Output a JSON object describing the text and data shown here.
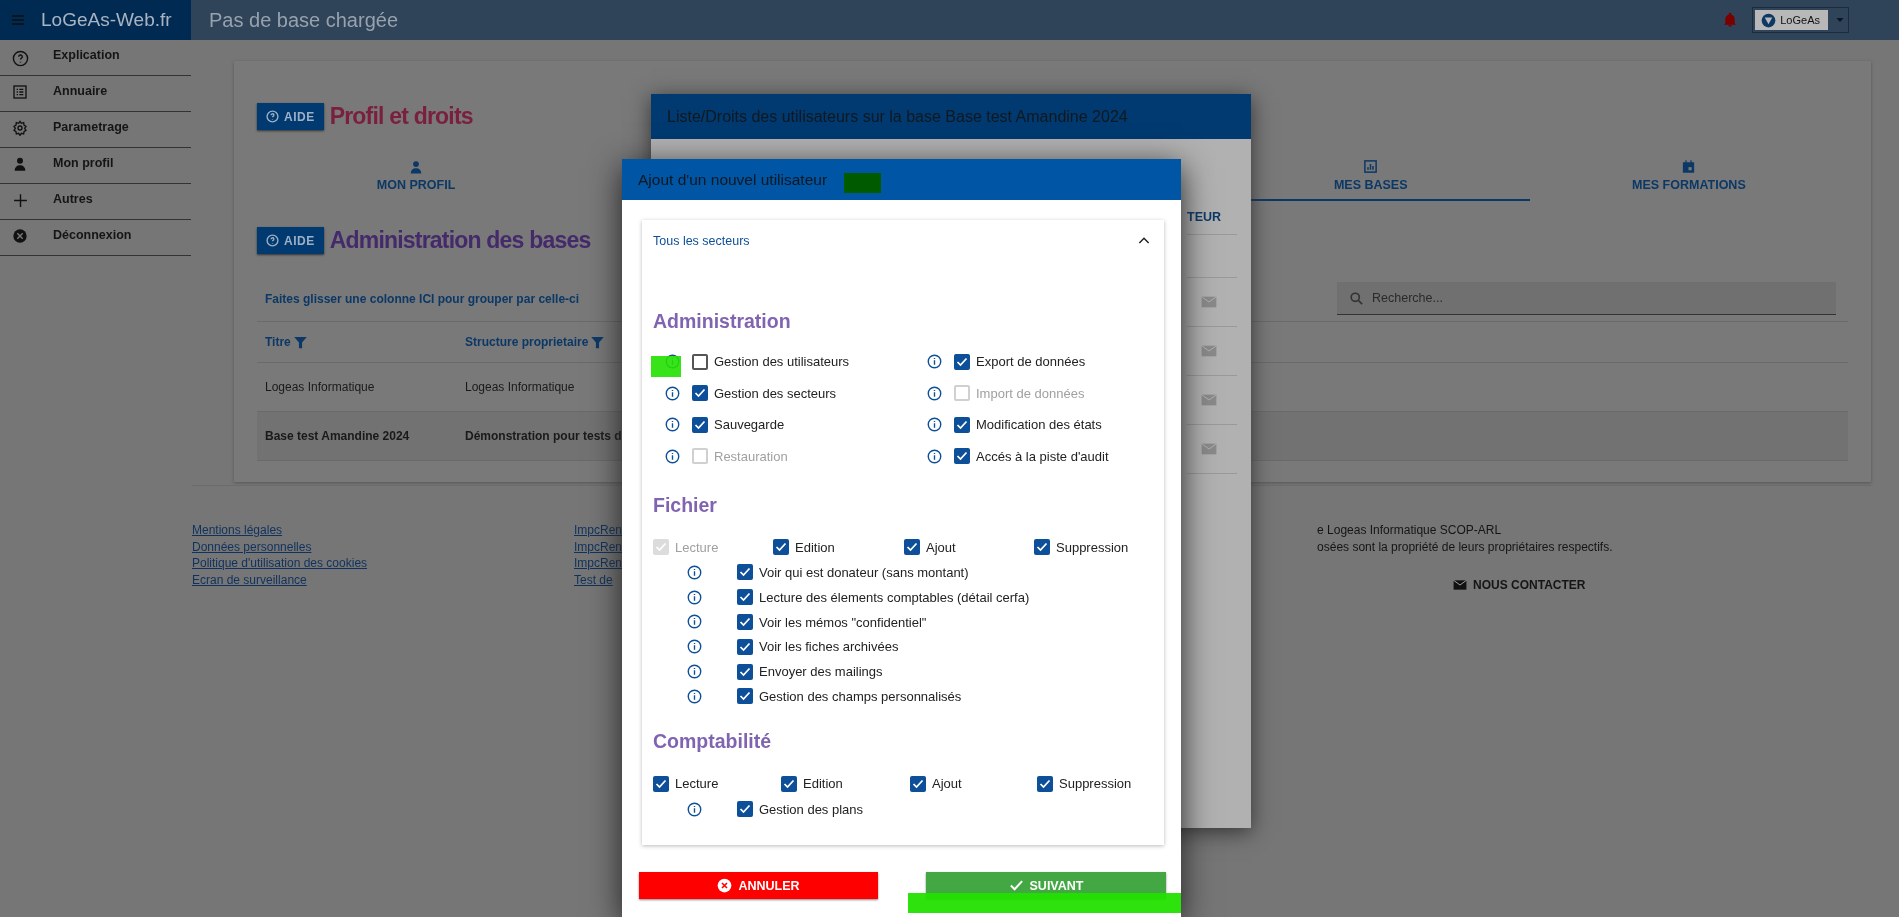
{
  "app_bar": {
    "brand": "LoGeAs-Web.fr",
    "title": "Pas de base chargée",
    "user_button": "LoGeAs"
  },
  "sidebar": {
    "items": [
      {
        "label": "Explication"
      },
      {
        "label": "Annuaire"
      },
      {
        "label": "Parametrage"
      },
      {
        "label": "Mon profil"
      },
      {
        "label": "Autres"
      },
      {
        "label": "Déconnexion"
      }
    ]
  },
  "profile_section": {
    "help_button": "AIDE",
    "title": "Profil et droits",
    "tabs": [
      {
        "label": "MON PROFIL",
        "selected": false
      },
      {
        "label": "MES BASES",
        "selected": true
      },
      {
        "label": "MES FORMATIONS",
        "selected": false
      }
    ]
  },
  "bases_section": {
    "help_button": "AIDE",
    "title": "Administration des bases",
    "group_hint": "Faites glisser une colonne ICI pour grouper par celle-ci",
    "search": {
      "placeholder": "Recherche..."
    },
    "columns": [
      "Titre",
      "Structure proprietaire"
    ],
    "rows": [
      {
        "cells": [
          "Logeas Informatique",
          "Logeas Informatique"
        ],
        "selected": false
      },
      {
        "cells": [
          "Base test Amandine 2024",
          "Démonstration pour tests d"
        ],
        "selected": true
      }
    ]
  },
  "footer": {
    "links": [
      "Mentions légales",
      "Données personnelles",
      "Politique d'utilisation des cookies",
      "Ecran de surveillance"
    ],
    "links_2": [
      "ImpcRen",
      "ImpcRen",
      "ImpcRen",
      "Test de"
    ],
    "notice_lines": [
      "e Logeas Informatique SCOP-ARL",
      "osées sont la propriété de leurs propriétaires respectifs."
    ],
    "contact_button": "NOUS CONTACTER"
  },
  "users_dialog": {
    "title": "Liste/Droits des utilisateurs sur la base Base test Amandine 2024",
    "column_header": "TEUR"
  },
  "new_user_dialog": {
    "title": "Ajout d'un nouvel utilisateur",
    "sectors": {
      "label": "Tous les secteurs",
      "expanded": true
    },
    "sections": [
      {
        "title": "Administration",
        "kind": "two_column",
        "options": [
          {
            "label": "Gestion des utilisateurs",
            "checked": false,
            "disabled": false
          },
          {
            "label": "Export de données",
            "checked": true,
            "disabled": false
          },
          {
            "label": "Gestion des secteurs",
            "checked": true,
            "disabled": false
          },
          {
            "label": "Import de données",
            "checked": false,
            "disabled": true
          },
          {
            "label": "Sauvegarde",
            "checked": true,
            "disabled": false
          },
          {
            "label": "Modification des états",
            "checked": true,
            "disabled": false
          },
          {
            "label": "Restauration",
            "checked": false,
            "disabled": true
          },
          {
            "label": "Accés à la piste d'audit",
            "checked": true,
            "disabled": false
          }
        ]
      },
      {
        "title": "Fichier",
        "kind": "rights",
        "basic": [
          {
            "label": "Lecture",
            "checked": true,
            "disabled": true
          },
          {
            "label": "Edition",
            "checked": true,
            "disabled": false
          },
          {
            "label": "Ajout",
            "checked": true,
            "disabled": false
          },
          {
            "label": "Suppression",
            "checked": true,
            "disabled": false
          }
        ],
        "options": [
          {
            "label": "Voir qui est donateur (sans montant)",
            "checked": true,
            "disabled": false
          },
          {
            "label": "Lecture des élements comptables (détail cerfa)",
            "checked": true,
            "disabled": false
          },
          {
            "label": "Voir les mémos \"confidentiel\"",
            "checked": true,
            "disabled": false
          },
          {
            "label": "Voir les fiches archivées",
            "checked": true,
            "disabled": false
          },
          {
            "label": "Envoyer des mailings",
            "checked": true,
            "disabled": false
          },
          {
            "label": "Gestion des champs personnalisés",
            "checked": true,
            "disabled": false
          }
        ]
      },
      {
        "title": "Comptabilité",
        "kind": "rights",
        "basic": [
          {
            "label": "Lecture",
            "checked": true,
            "disabled": false
          },
          {
            "label": "Edition",
            "checked": true,
            "disabled": false
          },
          {
            "label": "Ajout",
            "checked": true,
            "disabled": false
          },
          {
            "label": "Suppression",
            "checked": true,
            "disabled": false
          }
        ],
        "options": [
          {
            "label": "Gestion des plans",
            "checked": true,
            "disabled": false
          }
        ]
      }
    ],
    "buttons": {
      "cancel": "ANNULER",
      "next": "SUIVANT"
    }
  }
}
